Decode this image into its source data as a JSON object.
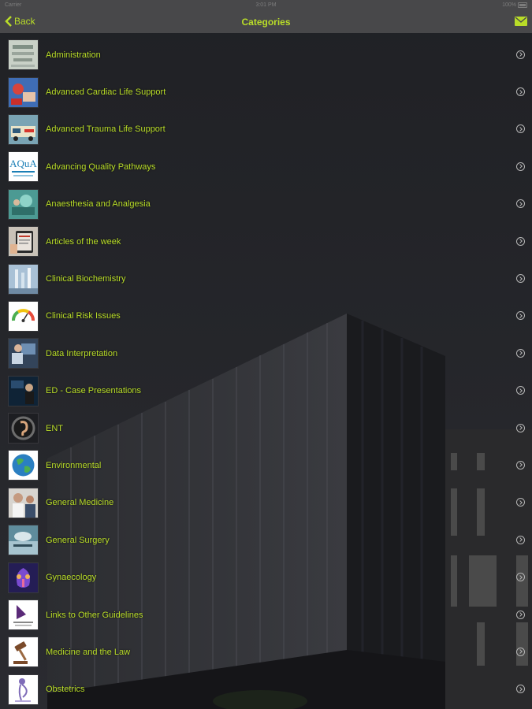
{
  "status_bar": {
    "carrier": "Carrier",
    "time": "3:01 PM",
    "battery": "100%"
  },
  "nav": {
    "back_label": "Back",
    "title": "Categories"
  },
  "colors": {
    "accent": "#b9dd28",
    "nav_bg": "#48484a",
    "page_bg": "#1d1e22"
  },
  "categories": [
    {
      "label": "Administration",
      "icon": "documents-photo-icon"
    },
    {
      "label": "Advanced Cardiac Life Support",
      "icon": "cpr-photo-icon"
    },
    {
      "label": "Advanced Trauma Life Support",
      "icon": "ambulance-photo-icon"
    },
    {
      "label": "Advancing Quality Pathways",
      "icon": "aqua-logo-icon"
    },
    {
      "label": "Anaesthesia and Analgesia",
      "icon": "theatre-photo-icon"
    },
    {
      "label": "Articles of the week",
      "icon": "tablet-photo-icon"
    },
    {
      "label": "Clinical Biochemistry",
      "icon": "lab-photo-icon"
    },
    {
      "label": "Clinical Risk Issues",
      "icon": "risk-gauge-icon"
    },
    {
      "label": "Data Interpretation",
      "icon": "data-photo-icon"
    },
    {
      "label": "ED - Case Presentations",
      "icon": "presentation-photo-icon"
    },
    {
      "label": "ENT",
      "icon": "ear-icon"
    },
    {
      "label": "Environmental",
      "icon": "globe-icon"
    },
    {
      "label": "General Medicine",
      "icon": "doctors-photo-icon"
    },
    {
      "label": "General Surgery",
      "icon": "surgery-photo-icon"
    },
    {
      "label": "Gynaecology",
      "icon": "anatomy-icon"
    },
    {
      "label": "Links to Other Guidelines",
      "icon": "guidelines-logo-icon"
    },
    {
      "label": "Medicine and the Law",
      "icon": "gavel-icon"
    },
    {
      "label": "Obstetrics",
      "icon": "pregnancy-icon"
    }
  ]
}
